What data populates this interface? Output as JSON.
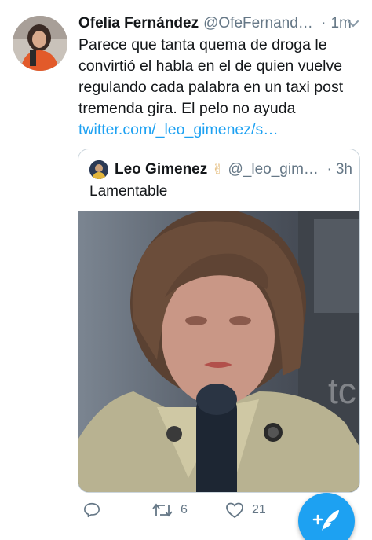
{
  "tweet": {
    "author_name": "Ofelia Fernández",
    "author_handle": "@OfeFernandez_",
    "separator": "·",
    "time": "1m",
    "lines": [
      "Parece que tanta quema de droga le",
      "convirtió el habla en el de quien vuelve",
      "regulando cada palabra en un taxi post",
      "tremenda gira. El pelo no ayuda"
    ],
    "link": "twitter.com/_leo_gimenez/s…"
  },
  "quoted_tweet": {
    "author_name": "Leo Gimenez",
    "emoji": "✌",
    "author_handle": "@_leo_gimenez",
    "separator": "·",
    "time": "3h",
    "text": "Lamentable",
    "media_watermark": "tc"
  },
  "actions": {
    "reply_count": "",
    "retweet_count": "6",
    "like_count": "21"
  },
  "icons": {
    "reply": "reply-icon",
    "retweet": "retweet-icon",
    "like": "heart-icon",
    "compose": "compose-tweet-icon",
    "caret": "chevron-down-icon"
  },
  "colors": {
    "accent": "#1da1f2",
    "secondary_text": "#657786",
    "border": "#ccd6dd"
  }
}
